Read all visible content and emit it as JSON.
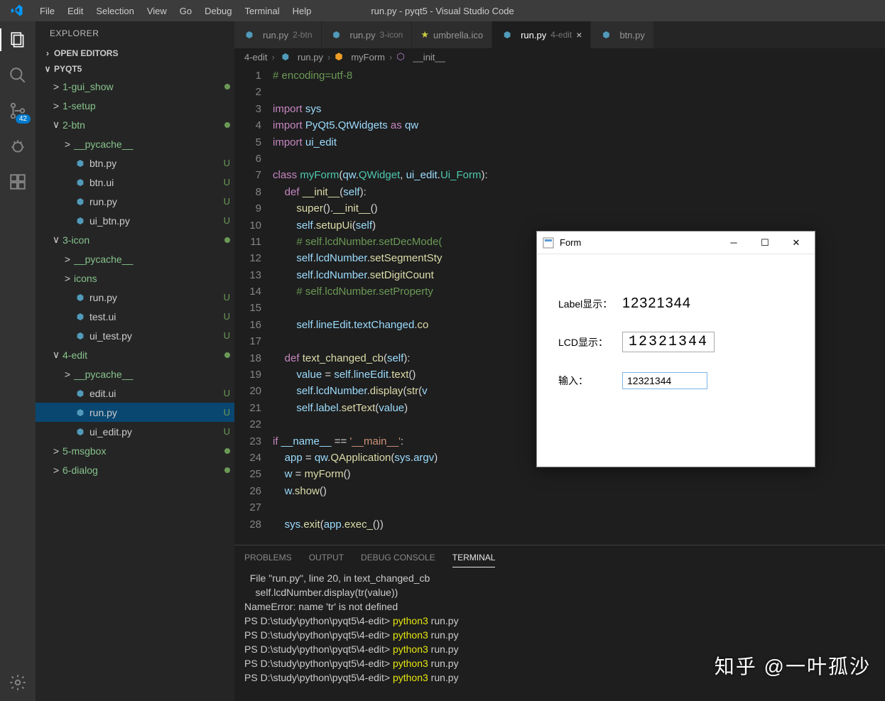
{
  "window": {
    "title": "run.py - pyqt5 - Visual Studio Code"
  },
  "menu": [
    "File",
    "Edit",
    "Selection",
    "View",
    "Go",
    "Debug",
    "Terminal",
    "Help"
  ],
  "activity": {
    "scm_badge": "42"
  },
  "sidebar": {
    "title": "EXPLORER",
    "open_editors": "OPEN EDITORS",
    "project": "PYQT5",
    "tree": [
      {
        "ind": 1,
        "chev": ">",
        "label": "1-gui_show",
        "dot": true,
        "folder": true
      },
      {
        "ind": 1,
        "chev": ">",
        "label": "1-setup",
        "folder": true
      },
      {
        "ind": 1,
        "chev": "∨",
        "label": "2-btn",
        "dot": true,
        "folder": true
      },
      {
        "ind": 2,
        "chev": ">",
        "label": "__pycache__",
        "folder": true
      },
      {
        "ind": 2,
        "icon": "py",
        "label": "btn.py",
        "status": "U"
      },
      {
        "ind": 2,
        "icon": "ui",
        "label": "btn.ui",
        "status": "U"
      },
      {
        "ind": 2,
        "icon": "py",
        "label": "run.py",
        "status": "U"
      },
      {
        "ind": 2,
        "icon": "py",
        "label": "ui_btn.py",
        "status": "U"
      },
      {
        "ind": 1,
        "chev": "∨",
        "label": "3-icon",
        "dot": true,
        "folder": true
      },
      {
        "ind": 2,
        "chev": ">",
        "label": "__pycache__",
        "folder": true
      },
      {
        "ind": 2,
        "chev": ">",
        "label": "icons",
        "folder": true
      },
      {
        "ind": 2,
        "icon": "py",
        "label": "run.py",
        "status": "U"
      },
      {
        "ind": 2,
        "icon": "ui",
        "label": "test.ui",
        "status": "U"
      },
      {
        "ind": 2,
        "icon": "py",
        "label": "ui_test.py",
        "status": "U"
      },
      {
        "ind": 1,
        "chev": "∨",
        "label": "4-edit",
        "dot": true,
        "folder": true
      },
      {
        "ind": 2,
        "chev": ">",
        "label": "__pycache__",
        "folder": true
      },
      {
        "ind": 2,
        "icon": "ui",
        "label": "edit.ui",
        "status": "U"
      },
      {
        "ind": 2,
        "icon": "py",
        "label": "run.py",
        "status": "U",
        "selected": true
      },
      {
        "ind": 2,
        "icon": "py",
        "label": "ui_edit.py",
        "status": "U"
      },
      {
        "ind": 1,
        "chev": ">",
        "label": "5-msgbox",
        "dot": true,
        "folder": true
      },
      {
        "ind": 1,
        "chev": ">",
        "label": "6-dialog",
        "dot": true,
        "folder": true
      }
    ]
  },
  "tabs": [
    {
      "icon": "py",
      "name": "run.py",
      "desc": "2-btn"
    },
    {
      "icon": "py",
      "name": "run.py",
      "desc": "3-icon"
    },
    {
      "icon": "ico",
      "name": "umbrella.ico"
    },
    {
      "icon": "py",
      "name": "run.py",
      "desc": "4-edit",
      "active": true,
      "close": true
    },
    {
      "icon": "py",
      "name": "btn.py"
    }
  ],
  "breadcrumb": {
    "p0": "4-edit",
    "p1": "run.py",
    "p2": "myForm",
    "p3": "__init__"
  },
  "code_lines": 28,
  "panel": {
    "tabs": [
      "PROBLEMS",
      "OUTPUT",
      "DEBUG CONSOLE",
      "TERMINAL"
    ],
    "active": "TERMINAL",
    "lines": [
      {
        "t": "  File \"run.py\", line 20, in text_changed_cb"
      },
      {
        "t": "    self.lcdNumber.display(tr(value))"
      },
      {
        "t": "NameError: name 'tr' is not defined"
      },
      {
        "prompt": "PS D:\\study\\python\\pyqt5\\4-edit>",
        "cmd": "python3",
        "arg": "run.py"
      },
      {
        "prompt": "PS D:\\study\\python\\pyqt5\\4-edit>",
        "cmd": "python3",
        "arg": "run.py"
      },
      {
        "prompt": "PS D:\\study\\python\\pyqt5\\4-edit>",
        "cmd": "python3",
        "arg": "run.py"
      },
      {
        "prompt": "PS D:\\study\\python\\pyqt5\\4-edit>",
        "cmd": "python3",
        "arg": "run.py"
      },
      {
        "prompt": "PS D:\\study\\python\\pyqt5\\4-edit>",
        "cmd": "python3",
        "arg": "run.py"
      }
    ]
  },
  "form": {
    "title": "Form",
    "label_lbl": "Label显示：",
    "label_val": "12321344",
    "lcd_lbl": "LCD显示：",
    "lcd_val": "12321344",
    "input_lbl": "输入：",
    "input_val": "12321344"
  },
  "watermark": "知乎 @一叶孤沙"
}
